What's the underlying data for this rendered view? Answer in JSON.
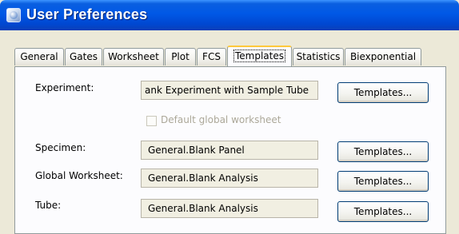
{
  "window": {
    "title": "User Preferences"
  },
  "tabs": [
    {
      "label": "General"
    },
    {
      "label": "Gates"
    },
    {
      "label": "Worksheet"
    },
    {
      "label": "Plot"
    },
    {
      "label": "FCS"
    },
    {
      "label": "Templates",
      "active": true
    },
    {
      "label": "Statistics"
    },
    {
      "label": "Biexponential"
    }
  ],
  "templates": {
    "experiment": {
      "label": "Experiment:",
      "value": "ank Experiment with Sample Tube",
      "button": "Templates..."
    },
    "default_global_worksheet": {
      "label": "Default global worksheet",
      "checked": false,
      "enabled": false
    },
    "specimen": {
      "label": "Specimen:",
      "value": "General.Blank Panel",
      "button": "Templates..."
    },
    "global_worksheet": {
      "label": "Global Worksheet:",
      "value": "General.Blank Analysis",
      "button": "Templates..."
    },
    "tube": {
      "label": "Tube:",
      "value": "General.Blank Analysis",
      "button": "Templates..."
    }
  }
}
